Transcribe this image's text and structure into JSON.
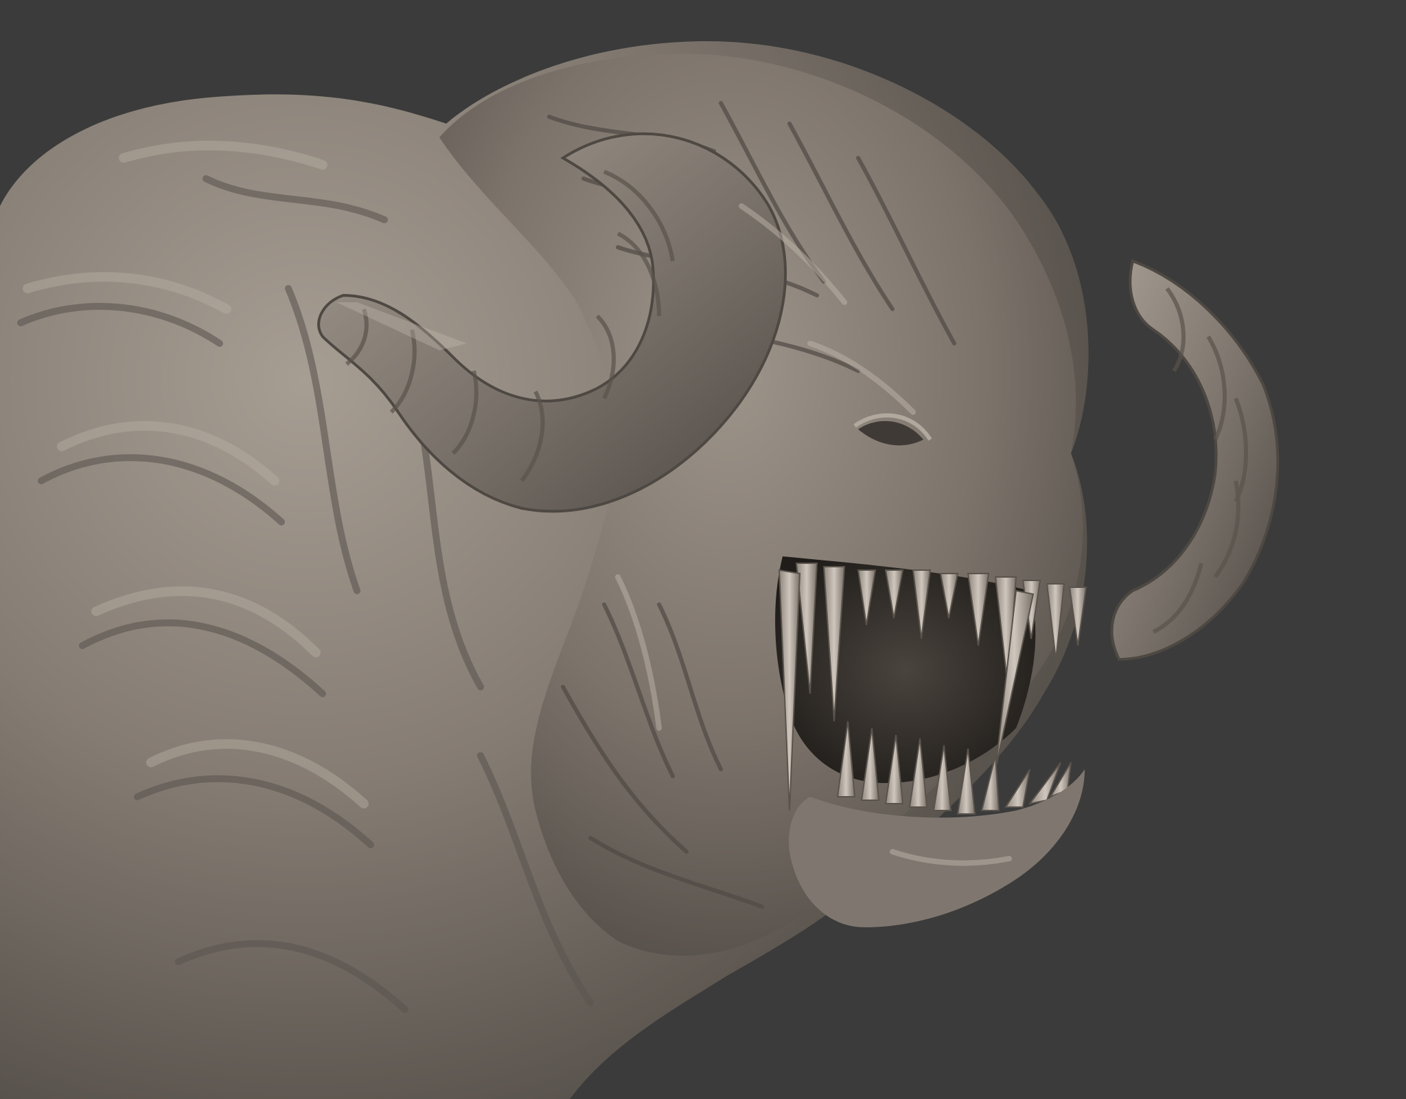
{
  "viewport": {
    "background_color": "#3b3b3b",
    "model_color": "#7f776f",
    "model_shadow_color": "#3e3a36",
    "model_highlight_color": "#c8c0b6",
    "horn_color": "#8b8279",
    "tooth_color": "#b3aba1",
    "mouth_color": "#26221f"
  },
  "model": {
    "icon": "clay-sculpt-render"
  }
}
